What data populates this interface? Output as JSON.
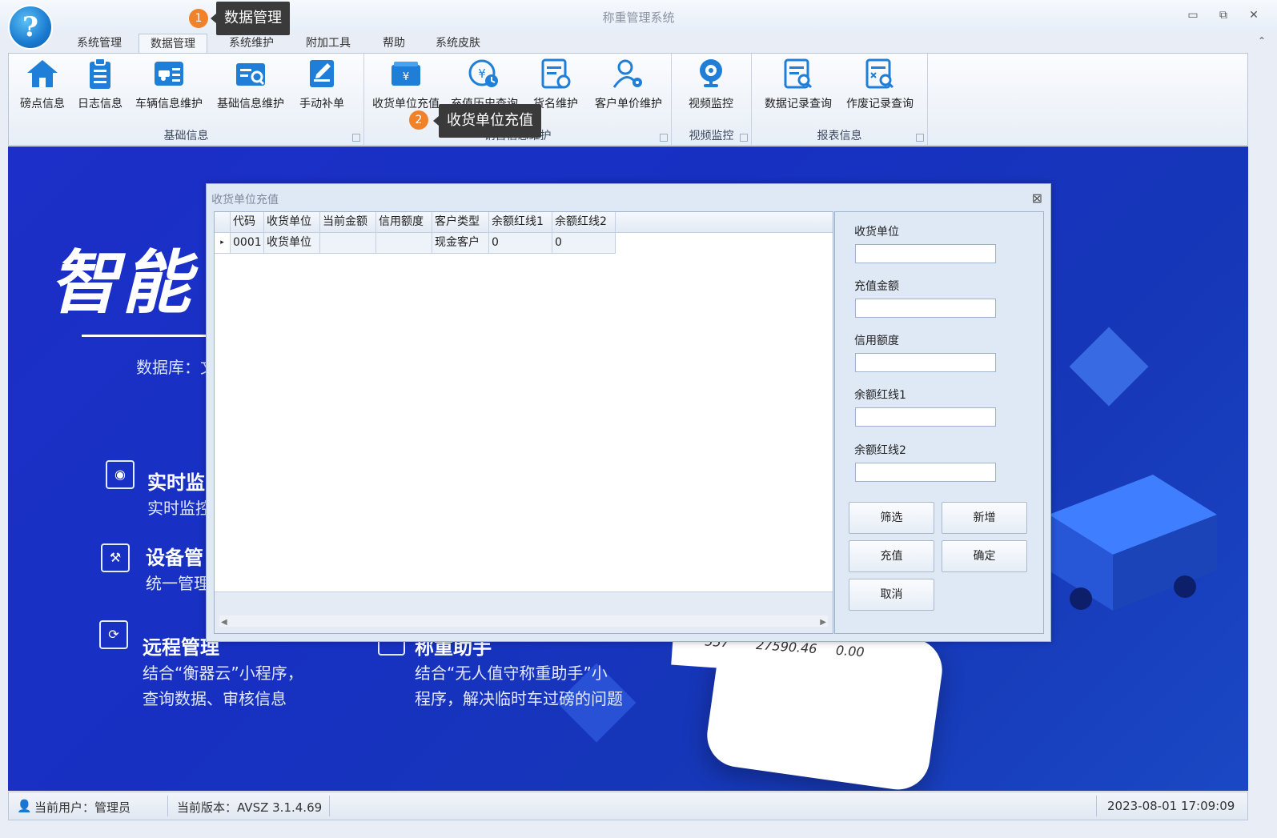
{
  "app": {
    "title": "称重管理系统"
  },
  "window_controls": {
    "minimize": "▭",
    "restore": "⧉",
    "close": "✕",
    "collapse_ribbon": "⌃"
  },
  "tabs": [
    {
      "label": "系统管理"
    },
    {
      "label": "数据管理"
    },
    {
      "label": "系统维护"
    },
    {
      "label": "附加工具"
    },
    {
      "label": "帮助"
    },
    {
      "label": "系统皮肤"
    }
  ],
  "ribbon": {
    "groups": [
      {
        "label": "基础信息"
      },
      {
        "label": "销售信息维护"
      },
      {
        "label": "视频监控"
      },
      {
        "label": "报表信息"
      }
    ],
    "buttons": [
      {
        "label": "磅点信息",
        "icon": "home-icon"
      },
      {
        "label": "日志信息",
        "icon": "clipboard-icon"
      },
      {
        "label": "车辆信息维护",
        "icon": "vehicle-card-icon"
      },
      {
        "label": "基础信息维护",
        "icon": "info-search-icon"
      },
      {
        "label": "手动补单",
        "icon": "edit-document-icon"
      },
      {
        "label": "收货单位充值",
        "icon": "wallet-yuan-icon"
      },
      {
        "label": "充值历史查询",
        "icon": "yuan-clock-icon"
      },
      {
        "label": "货名维护",
        "icon": "goods-settings-icon"
      },
      {
        "label": "客户单价维护",
        "icon": "user-gear-icon"
      },
      {
        "label": "视频监控",
        "icon": "webcam-icon"
      },
      {
        "label": "数据记录查询",
        "icon": "record-search-icon"
      },
      {
        "label": "作废记录查询",
        "icon": "void-record-icon"
      }
    ]
  },
  "callouts": [
    {
      "badge": "1",
      "text": "数据管理"
    },
    {
      "badge": "2",
      "text": "收货单位充值"
    }
  ],
  "background": {
    "title": "智能",
    "db_label": "数据库：文",
    "features": [
      {
        "title": "实时监",
        "desc": "实时监控"
      },
      {
        "title": "设备管",
        "desc": "统一管理"
      },
      {
        "title": "远程管理",
        "desc1": "结合“衡器云”小程序，",
        "desc2": "查询数据、审核信息"
      },
      {
        "title": "称重助手",
        "desc1": "结合“无人值守称重助手”小",
        "desc2": "程序，解决临时车过磅的问题"
      }
    ],
    "receipt": [
      "557",
      "27590.46",
      "0.00"
    ]
  },
  "dialog": {
    "title": "收货单位充值",
    "columns": [
      "代码",
      "收货单位",
      "当前金额",
      "信用额度",
      "客户类型",
      "余额红线1",
      "余额红线2"
    ],
    "rows": [
      [
        "0001",
        "收货单位",
        "",
        "",
        "现金客户",
        "0",
        "0"
      ]
    ],
    "row_indicator": "▸",
    "fields": [
      {
        "label": "收货单位",
        "value": ""
      },
      {
        "label": "充值金额",
        "value": ""
      },
      {
        "label": "信用额度",
        "value": ""
      },
      {
        "label": "余额红线1",
        "value": ""
      },
      {
        "label": "余额红线2",
        "value": ""
      }
    ],
    "buttons": {
      "filter": "筛选",
      "add": "新增",
      "recharge": "充值",
      "confirm": "确定",
      "cancel": "取消"
    }
  },
  "status": {
    "user": "当前用户：管理员",
    "version": "当前版本：AVSZ 3.1.4.69",
    "datetime": "2023-08-01 17:09:09"
  }
}
